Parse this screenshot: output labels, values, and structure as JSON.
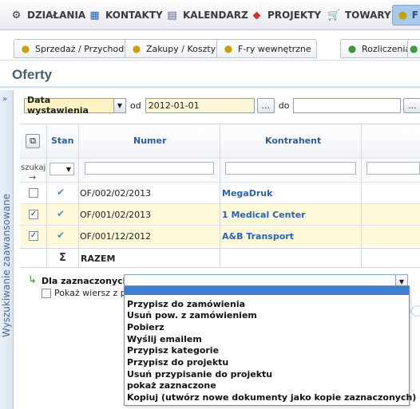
{
  "nav": {
    "items": [
      {
        "label": "DZIAŁANIA",
        "icon": "gear-icon"
      },
      {
        "label": "KONTAKTY",
        "icon": "address-book-icon"
      },
      {
        "label": "KALENDARZ",
        "icon": "calendar-icon"
      },
      {
        "label": "PROJEKTY",
        "icon": "cubes-icon"
      },
      {
        "label": "TOWARY",
        "icon": "cart-icon"
      },
      {
        "label": "F",
        "icon": "coins-icon"
      }
    ]
  },
  "subtabs": [
    {
      "label": "Sprzedaż / Przychody",
      "icon": "coins-icon"
    },
    {
      "label": "Zakupy / Koszty",
      "icon": "coins-icon"
    },
    {
      "label": "F-ry wewnętrzne",
      "icon": "coins-icon"
    },
    {
      "label": "Rozliczenia",
      "icon": "coins-icon"
    }
  ],
  "page": {
    "title": "Oferty"
  },
  "advanced_search": {
    "label": "Wyszukiwanie zaawansowane"
  },
  "filter": {
    "field_label": "Data wystawienia",
    "from_label": "od",
    "from_value": "2012-01-01",
    "to_label": "do",
    "to_value": "",
    "picker_label": "..."
  },
  "grid": {
    "search_label": "szukaj",
    "columns": {
      "status": "Stan",
      "number": "Numer",
      "contractor": "Kontrahent"
    },
    "rows": [
      {
        "checked": false,
        "number": "OF/002/02/2013",
        "contractor": "MegaDruk"
      },
      {
        "checked": true,
        "number": "OF/001/02/2013",
        "contractor": "1 Medical Center"
      },
      {
        "checked": true,
        "number": "OF/001/12/2012",
        "contractor": "A&B Transport"
      }
    ],
    "sum_symbol": "Σ",
    "sum_label": "RAZEM"
  },
  "bulk": {
    "label": "Dla zaznaczonych:",
    "show_row_label": "Pokaż wiersz z pod",
    "options": [
      "Przypisz do zamówienia",
      "Usuń pow. z zamówieniem",
      "Pobierz",
      "Wyślij emailem",
      "Przypisz kategorie",
      "Przypisz do projektu",
      "Usuń przypisanie do projektu",
      "pokaż zaznaczone",
      "Kopiuj (utwórz nowe dokumenty jako kopie zaznaczonych)"
    ]
  },
  "colors": {
    "accent": "#2e5d9a",
    "selected_row": "#fdf9d9",
    "dropdown_highlight": "#3e7fd4"
  }
}
